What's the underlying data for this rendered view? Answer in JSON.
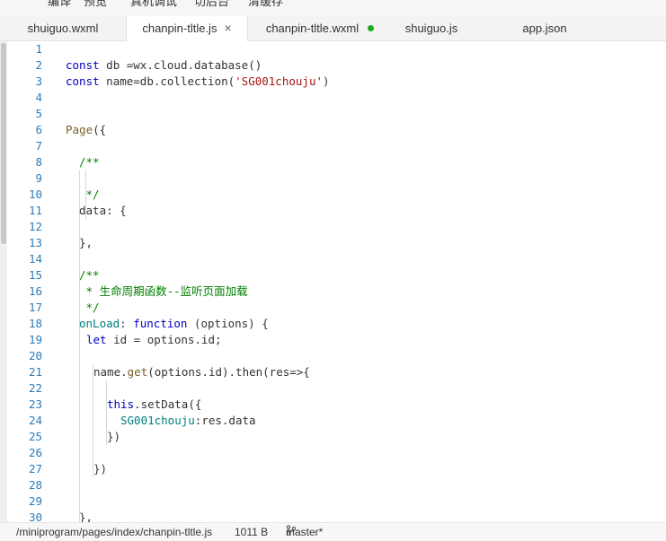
{
  "toolbar": {
    "items": [
      "编译",
      "预览",
      "真机调试",
      "切后台",
      "清缓存"
    ]
  },
  "tabs": [
    {
      "label": "shuiguo.wxml"
    },
    {
      "label": "chanpin-tltle.js",
      "close": "×"
    },
    {
      "label": "chanpin-tltle.wxml"
    },
    {
      "label": "shuiguo.js"
    },
    {
      "label": "app.json"
    }
  ],
  "editor": {
    "line_numbers": [
      "1",
      "2",
      "3",
      "4",
      "5",
      "6",
      "7",
      "8",
      "9",
      "10",
      "11",
      "12",
      "13",
      "14",
      "15",
      "16",
      "17",
      "18",
      "19",
      "20",
      "21",
      "22",
      "23",
      "24",
      "25",
      "26",
      "27",
      "28",
      "29",
      "30"
    ],
    "lines": {
      "l2": {
        "kw": "const",
        "rest": " db =wx.cloud.database()"
      },
      "l3": {
        "kw": "const",
        "rest": " name=db.collection(",
        "str": "'SG001chouju'",
        "end": ")"
      },
      "l6": {
        "fn": "Page",
        "rest": "({"
      },
      "l8": {
        "cmt": "/**"
      },
      "l10": {
        "cmt": " */"
      },
      "l11": {
        "text": "data: {"
      },
      "l13": {
        "text": "},"
      },
      "l15": {
        "cmt": "/**"
      },
      "l16": {
        "cmt": " * 生命周期函数--监听页面加载"
      },
      "l17": {
        "cmt": " */"
      },
      "l18": {
        "a": "onLoad",
        "b": ": ",
        "kw": "function",
        "c": " (options) {"
      },
      "l19": {
        "kw": "let",
        "rest": " id = options.id;"
      },
      "l21": {
        "a": "name.",
        "fn": "get",
        "rest": "(options.id).then(res=>{"
      },
      "l23": {
        "kw": "this",
        "rest": ".setData({"
      },
      "l24": {
        "prop": "SG001chouju",
        "rest": ":res.data"
      },
      "l25": {
        "text": "})"
      },
      "l27": {
        "text": "})"
      },
      "l30": {
        "text": "},"
      }
    }
  },
  "status": {
    "path": "/miniprogram/pages/index/chanpin-tltle.js",
    "size": "1011 B",
    "branch": "master*"
  }
}
